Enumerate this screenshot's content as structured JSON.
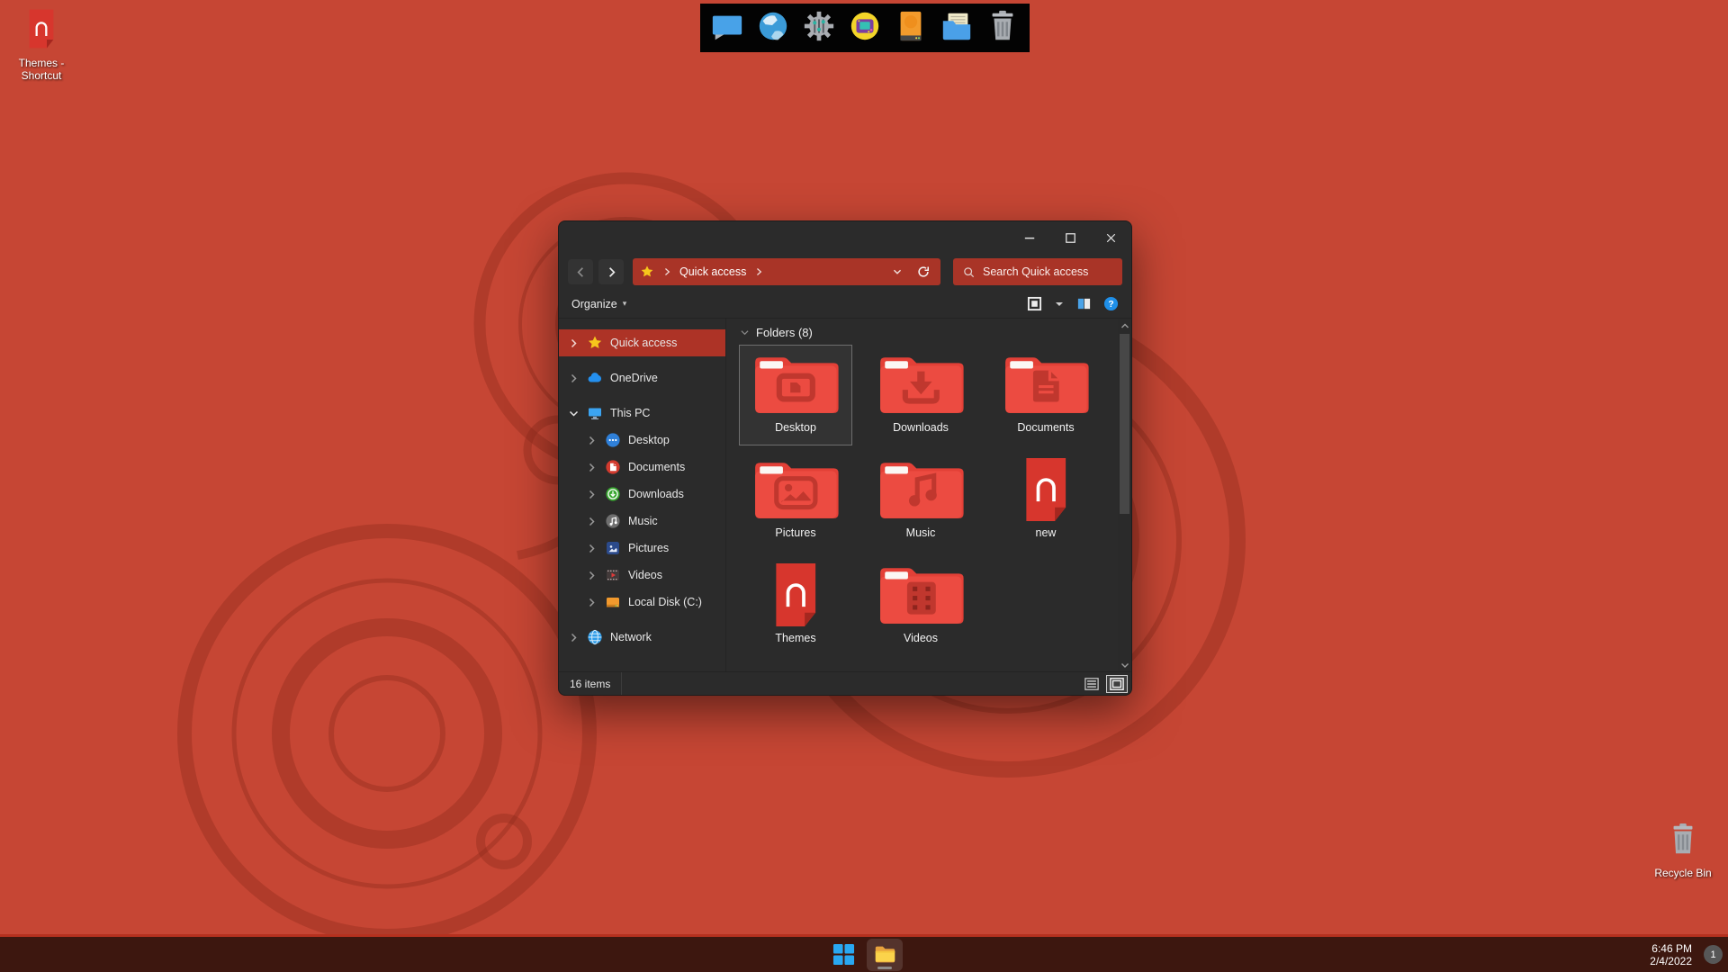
{
  "theme": {
    "desktop_red": "#c64634",
    "accent_red": "#a93427",
    "selection_red": "#ad3326",
    "folder_red": "#ec4b41",
    "taskbar_maroon": "#3d170f"
  },
  "desktop": {
    "shortcut_label": "Themes - Shortcut",
    "recycle_bin_label": "Recycle Bin"
  },
  "dock": {
    "items": [
      {
        "icon": "dock-pc"
      },
      {
        "icon": "dock-globe"
      },
      {
        "icon": "dock-gear"
      },
      {
        "icon": "dock-game"
      },
      {
        "icon": "dock-drive"
      },
      {
        "icon": "dock-files"
      },
      {
        "icon": "dock-trash"
      }
    ]
  },
  "window": {
    "address": {
      "root_icon": "star",
      "crumb": "Quick access"
    },
    "search_placeholder": "Search Quick access",
    "toolbar": {
      "organize_label": "Organize",
      "organize_caret": "▾"
    },
    "sidebar": {
      "items": [
        {
          "label": "Quick access",
          "icon": "star",
          "level": 0,
          "selected": true
        },
        {
          "label": "OneDrive",
          "icon": "cloud",
          "level": 0,
          "gap": true
        },
        {
          "label": "This PC",
          "icon": "monitor-mini",
          "level": 0,
          "expanded": true,
          "gap": true
        },
        {
          "label": "Desktop",
          "icon": "desktop-dots",
          "level": 1
        },
        {
          "label": "Documents",
          "icon": "documents-badge",
          "level": 1
        },
        {
          "label": "Downloads",
          "icon": "downloads-badge",
          "level": 1
        },
        {
          "label": "Music",
          "icon": "music-badge",
          "level": 1
        },
        {
          "label": "Pictures",
          "icon": "pictures-badge",
          "level": 1
        },
        {
          "label": "Videos",
          "icon": "videos-badge",
          "level": 1
        },
        {
          "label": "Local Disk (C:)",
          "icon": "drive-mini",
          "level": 1
        },
        {
          "label": "Network",
          "icon": "globe-mini",
          "level": 0,
          "gap": true
        }
      ]
    },
    "content": {
      "group_header": "Folders (8)",
      "tiles": [
        {
          "label": "Desktop",
          "icon": "folder-desktop",
          "selected": true
        },
        {
          "label": "Downloads",
          "icon": "folder-downloads"
        },
        {
          "label": "Documents",
          "icon": "folder-documents"
        },
        {
          "label": "Pictures",
          "icon": "folder-pictures"
        },
        {
          "label": "Music",
          "icon": "folder-music"
        },
        {
          "label": "new",
          "icon": "nfile"
        },
        {
          "label": "Themes",
          "icon": "nfile"
        },
        {
          "label": "Videos",
          "icon": "folder-videos"
        }
      ]
    },
    "statusbar": {
      "items_count": "16 items"
    }
  },
  "taskbar": {
    "tray_icons": [
      {
        "icon": "tray-chevron"
      },
      {
        "icon": "tray-sync"
      },
      {
        "icon": "tray-net"
      },
      {
        "icon": "tray-vol"
      },
      {
        "icon": "tray-batt"
      }
    ],
    "clock": {
      "time": "6:46 PM",
      "date": "2/4/2022"
    },
    "badge_count": "1"
  }
}
